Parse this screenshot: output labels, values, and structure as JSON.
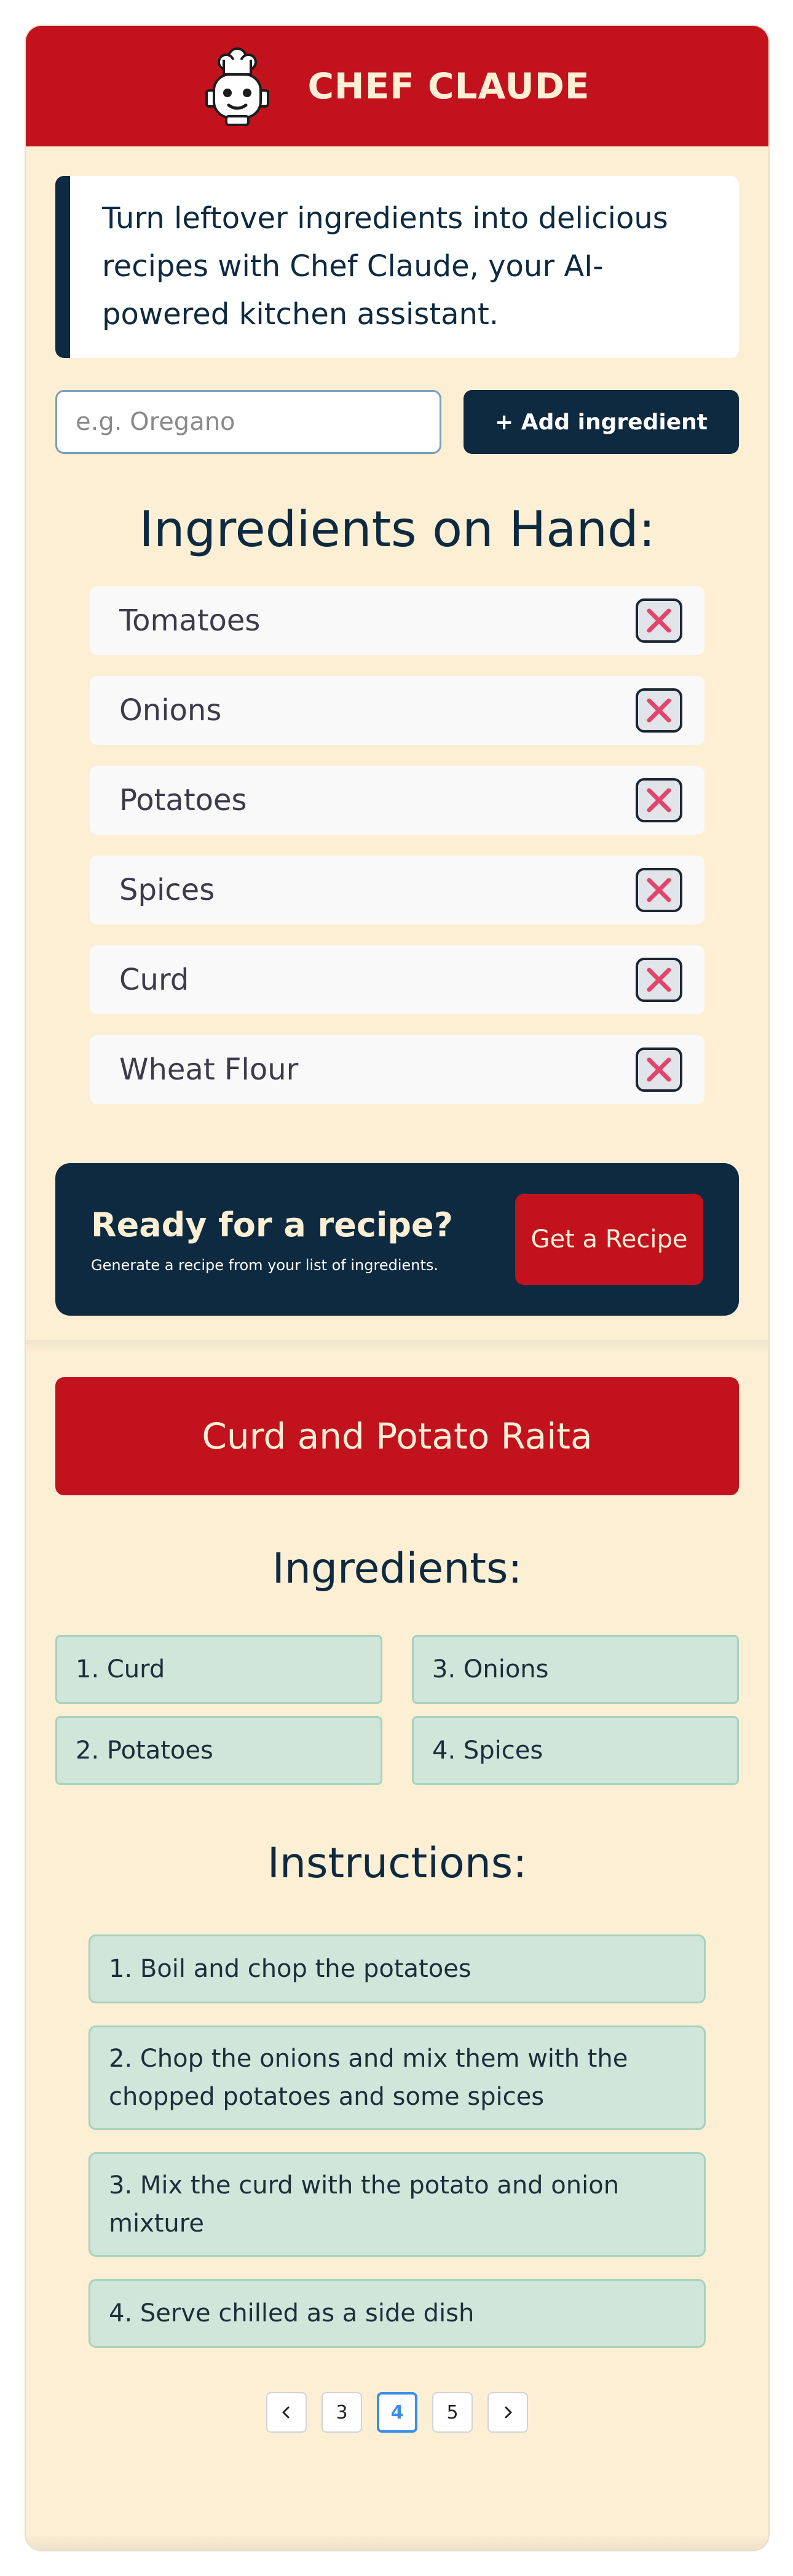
{
  "header": {
    "brand": "CHEF CLAUDE",
    "logo_icon": "chef-robot-icon"
  },
  "intro": {
    "text": "Turn leftover ingredients into delicious recipes with Chef Claude, your AI-powered kitchen assistant."
  },
  "add_form": {
    "placeholder": "e.g. Oregano",
    "button_label": "+ Add ingredient"
  },
  "on_hand": {
    "title": "Ingredients on Hand:",
    "items": [
      {
        "label": "Tomatoes"
      },
      {
        "label": "Onions"
      },
      {
        "label": "Potatoes"
      },
      {
        "label": "Spices"
      },
      {
        "label": "Curd"
      },
      {
        "label": "Wheat Flour"
      }
    ],
    "remove_icon": "close-x-icon"
  },
  "cta": {
    "title": "Ready for a recipe?",
    "subtitle": "Generate a recipe from your list of ingredients.",
    "button_label": "Get a Recipe"
  },
  "recipe": {
    "title": "Curd and Potato Raita",
    "ingredients_title": "Ingredients:",
    "ingredients": [
      "1. Curd",
      "3. Onions",
      "2. Potatoes",
      "4. Spices"
    ],
    "instructions_title": "Instructions:",
    "instructions": [
      "1. Boil and chop the potatoes",
      "2. Chop the onions and mix them with the chopped potatoes and some spices",
      "3. Mix the curd with the potato and onion mixture",
      "4. Serve chilled as a side dish"
    ]
  },
  "pagination": {
    "pages": [
      "3",
      "4",
      "5"
    ],
    "current": "4"
  },
  "colors": {
    "brand_red": "#c2121e",
    "navy": "#0e2a40",
    "cream": "#fcefd4",
    "mint": "#d0e6da",
    "delete_pink": "#e2456b",
    "active_blue": "#3b8ee8"
  }
}
